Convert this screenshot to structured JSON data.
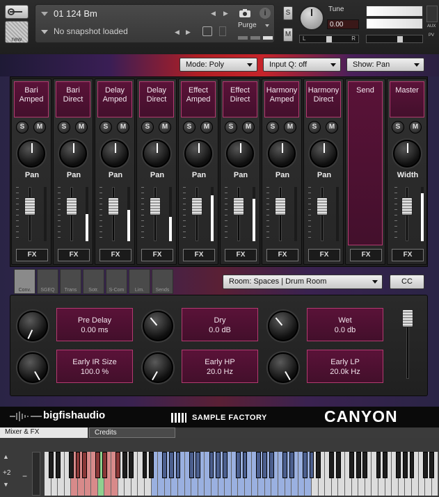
{
  "header": {
    "new_label": "new",
    "instrument_name": "01 124 Bm",
    "snapshot_text": "No snapshot loaded",
    "purge_label": "Purge",
    "solo_label": "S",
    "mute_label": "M",
    "tune_label": "Tune",
    "tune_value": "0.00",
    "pan_left": "L",
    "pan_right": "R",
    "aux_label": "AUX",
    "pv_label": "PV",
    "info_icon": "i",
    "camera_icon": "camera-icon"
  },
  "controls": {
    "mode": "Mode: Poly",
    "input_q": "Input Q: off",
    "show": "Show: Pan"
  },
  "channels": [
    {
      "line1": "Bari",
      "line2": "Amped",
      "knob": "Pan",
      "fx": "FX",
      "fader": 0.78,
      "meter": 0.0
    },
    {
      "line1": "Bari",
      "line2": "Direct",
      "knob": "Pan",
      "fx": "FX",
      "fader": 0.78,
      "meter": 0.5
    },
    {
      "line1": "Delay",
      "line2": "Amped",
      "knob": "Pan",
      "fx": "FX",
      "fader": 0.78,
      "meter": 0.58
    },
    {
      "line1": "Delay",
      "line2": "Direct",
      "knob": "Pan",
      "fx": "FX",
      "fader": 0.78,
      "meter": 0.45
    },
    {
      "line1": "Effect",
      "line2": "Amped",
      "knob": "Pan",
      "fx": "FX",
      "fader": 0.78,
      "meter": 0.85
    },
    {
      "line1": "Effect",
      "line2": "Direct",
      "knob": "Pan",
      "fx": "FX",
      "fader": 0.78,
      "meter": 0.78
    },
    {
      "line1": "Harmony",
      "line2": "Amped",
      "knob": "Pan",
      "fx": "FX",
      "fader": 0.78,
      "meter": 0.0
    },
    {
      "line1": "Harmony",
      "line2": "Direct",
      "knob": "Pan",
      "fx": "FX",
      "fader": 0.78,
      "meter": 0.0
    }
  ],
  "send": {
    "label": "Send",
    "fx": "FX"
  },
  "master": {
    "label": "Master",
    "knob": "Width",
    "fx": "FX",
    "fader": 0.78,
    "meter": 0.88
  },
  "solo": "S",
  "mute": "M",
  "effect_tabs": [
    "Conv.",
    "SGEQ",
    "Trans",
    "Sotr.",
    "S-Com",
    "Lim.",
    "Sends"
  ],
  "room_select": "Room: Spaces | Drum Room",
  "cc_label": "CC",
  "reverb": {
    "pre_delay": {
      "label": "Pre Delay",
      "value": "0.00 ms"
    },
    "dry": {
      "label": "Dry",
      "value": "0.0 dB"
    },
    "wet": {
      "label": "Wet",
      "value": "0.0 db"
    },
    "early_ir_size": {
      "label": "Early IR Size",
      "value": "100.0 %"
    },
    "early_hp": {
      "label": "Early HP",
      "value": "20.0 Hz"
    },
    "early_lp": {
      "label": "Early LP",
      "value": "20.0k Hz"
    }
  },
  "logos": {
    "bigfish": "bigfishaudio",
    "sample_factory": "SAMPLE FACTORY",
    "canyon": "CANYON"
  },
  "bottom_tabs": [
    "Mixer & FX",
    "Credits"
  ],
  "keyboard": {
    "octave_shift": "+2",
    "minus": "−"
  },
  "colors": {
    "channel_fill": "#4f1133",
    "channel_border": "#b33a70",
    "keyswitch_red": "#d88a8a",
    "keyswitch_green": "#8fd08f",
    "playable_blue": "#9ab0e0"
  }
}
